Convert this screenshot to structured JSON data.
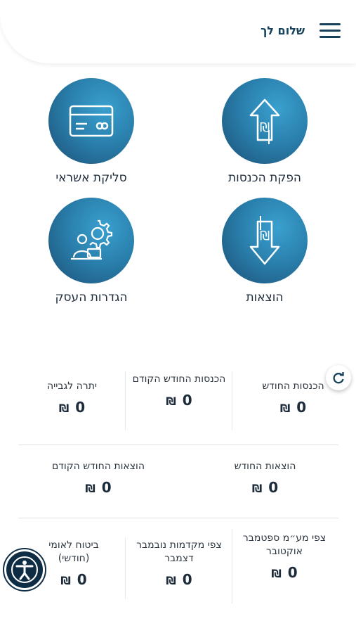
{
  "header": {
    "greeting": "שלום לך",
    "menu_icon": "hamburger-menu-icon"
  },
  "tiles": {
    "issue_income": {
      "label": "הפקת הכנסות",
      "icon": "upload-shekel-icon"
    },
    "credit_clearing": {
      "label": "סליקת אשראי",
      "icon": "credit-card-icon"
    },
    "expenses": {
      "label": "הוצאות",
      "icon": "download-shekel-icon"
    },
    "business_settings": {
      "label": "הגדרות העסק",
      "icon": "user-gear-icon"
    }
  },
  "stats": {
    "income_month": {
      "title": "הכנסות החודש",
      "value": "0",
      "currency": "₪"
    },
    "income_prev_month": {
      "title": "הכנסות החודש הקודם",
      "value": "0",
      "currency": "₪"
    },
    "balance_to_collect": {
      "title": "יתרה לגבייה",
      "value": "0",
      "currency": "₪"
    },
    "expenses_month": {
      "title": "הוצאות החודש",
      "value": "0",
      "currency": "₪"
    },
    "expenses_prev_month": {
      "title": "הוצאות החודש הקודם",
      "value": "0",
      "currency": "₪"
    },
    "vat_forecast": {
      "title": "צפי מע״מ ספטמבר אוקטובר",
      "value": "0",
      "currency": "₪"
    },
    "advance_forecast": {
      "title": "צפי מקדמות נובמבר דצמבר",
      "value": "0",
      "currency": "₪"
    },
    "national_insurance": {
      "title": "ביטוח לאומי (חודשי)",
      "value": "0",
      "currency": "₪"
    }
  },
  "controls": {
    "refresh_icon": "refresh-icon",
    "accessibility_icon": "accessibility-icon"
  },
  "colors": {
    "primary": "#16425b",
    "tile_light": "#3aa0cf",
    "tile_dark": "#1b4f75"
  }
}
